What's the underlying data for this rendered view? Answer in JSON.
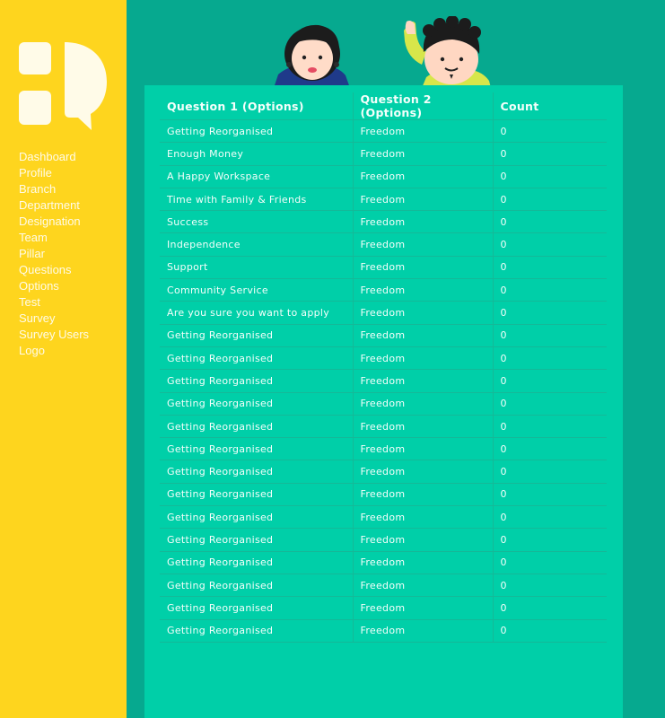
{
  "sidebar": {
    "items": [
      {
        "label": "Dashboard"
      },
      {
        "label": "Profile"
      },
      {
        "label": "Branch"
      },
      {
        "label": "Department"
      },
      {
        "label": "Designation"
      },
      {
        "label": "Team"
      },
      {
        "label": "Pillar"
      },
      {
        "label": "Questions"
      },
      {
        "label": "Options"
      },
      {
        "label": "Test"
      },
      {
        "label": "Survey"
      },
      {
        "label": "Survey Users"
      },
      {
        "label": "Logo"
      }
    ]
  },
  "table": {
    "headers": [
      "Question 1 (Options)",
      "Question 2 (Options)",
      "Count"
    ],
    "rows": [
      [
        "Getting Reorganised",
        "Freedom",
        "0"
      ],
      [
        "Enough Money",
        "Freedom",
        "0"
      ],
      [
        "A Happy Workspace",
        "Freedom",
        "0"
      ],
      [
        "Time with Family & Friends",
        "Freedom",
        "0"
      ],
      [
        "Success",
        "Freedom",
        "0"
      ],
      [
        "Independence",
        "Freedom",
        "0"
      ],
      [
        "Support",
        "Freedom",
        "0"
      ],
      [
        "Community Service",
        "Freedom",
        "0"
      ],
      [
        "Are you sure you want to apply",
        "Freedom",
        "0"
      ],
      [
        "Getting Reorganised",
        "Freedom",
        "0"
      ],
      [
        "Getting Reorganised",
        "Freedom",
        "0"
      ],
      [
        "Getting Reorganised",
        "Freedom",
        "0"
      ],
      [
        "Getting Reorganised",
        "Freedom",
        "0"
      ],
      [
        "Getting Reorganised",
        "Freedom",
        "0"
      ],
      [
        "Getting Reorganised",
        "Freedom",
        "0"
      ],
      [
        "Getting Reorganised",
        "Freedom",
        "0"
      ],
      [
        "Getting Reorganised",
        "Freedom",
        "0"
      ],
      [
        "Getting Reorganised",
        "Freedom",
        "0"
      ],
      [
        "Getting Reorganised",
        "Freedom",
        "0"
      ],
      [
        "Getting Reorganised",
        "Freedom",
        "0"
      ],
      [
        "Getting Reorganised",
        "Freedom",
        "0"
      ],
      [
        "Getting Reorganised",
        "Freedom",
        "0"
      ],
      [
        "Getting Reorganised",
        "Freedom",
        "0"
      ]
    ]
  },
  "icons": {
    "logo": "app-logo-icon",
    "illustration": "two-people-illustration"
  },
  "colors": {
    "sidebar": "#FED51E",
    "background": "#06A98F",
    "card": "#00CFA8",
    "text": "#F4FFFB"
  }
}
